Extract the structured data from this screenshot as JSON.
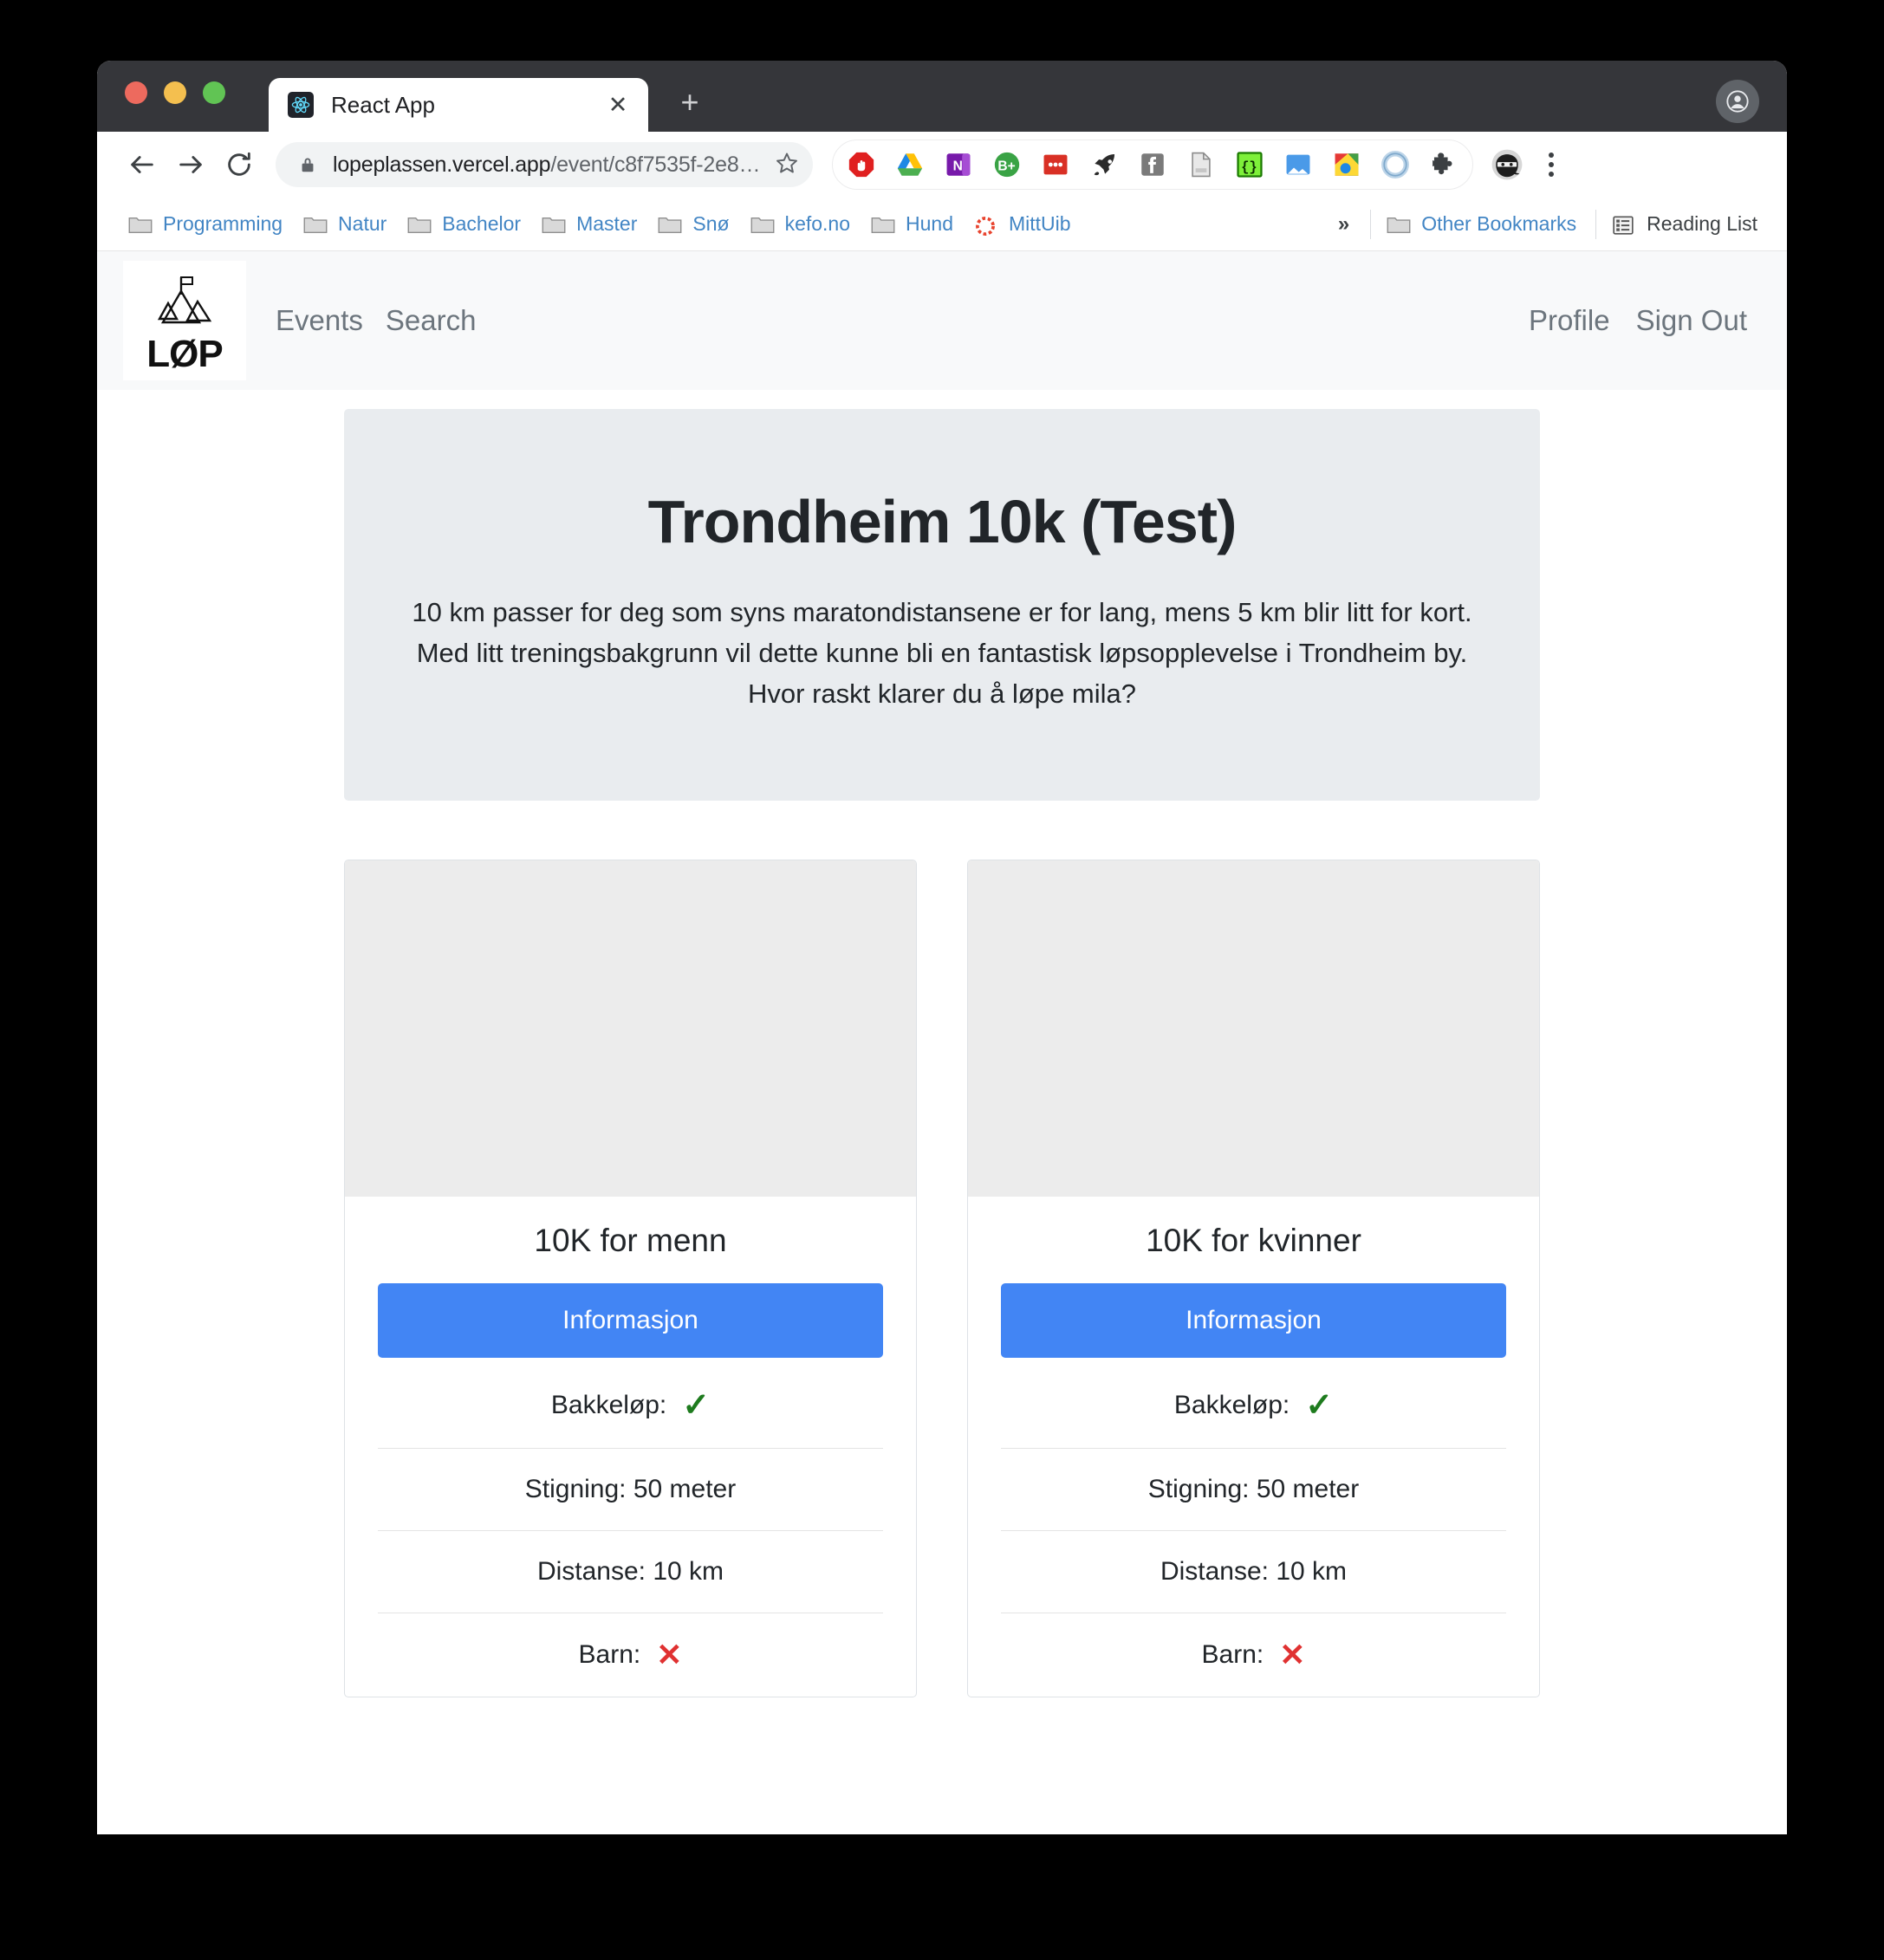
{
  "browser": {
    "tab": {
      "title": "React App",
      "favicon": "react-icon",
      "close_label": "✕"
    },
    "new_tab_label": "+",
    "toolbar": {
      "back_label": "←",
      "forward_label": "→",
      "reload_label": "⟳",
      "url_secure": "lopeplassen.vercel.app",
      "url_path": "/event/c8f7535f-2e8…",
      "url_full": "lopeplassen.vercel.app/event/c8f7535f-2e8…",
      "lock_icon": "lock-icon",
      "star_icon": "star-icon",
      "menu_icon": "kebab-menu-icon",
      "extensions": [
        "adblock-icon",
        "google-drive-icon",
        "onenote-icon",
        "bitwarden-icon",
        "red-dots-icon",
        "rocket-icon",
        "facebook-icon",
        "document-icon",
        "code-brackets-icon",
        "image-icon",
        "colorful-square-icon",
        "blue-ring-icon",
        "puzzle-piece-icon",
        "ninja-avatar-icon"
      ]
    },
    "bookmarks": [
      {
        "label": "Programming",
        "icon": "folder-icon"
      },
      {
        "label": "Natur",
        "icon": "folder-icon"
      },
      {
        "label": "Bachelor",
        "icon": "folder-icon"
      },
      {
        "label": "Master",
        "icon": "folder-icon"
      },
      {
        "label": "Snø",
        "icon": "folder-icon"
      },
      {
        "label": "kefo.no",
        "icon": "folder-icon"
      },
      {
        "label": "Hund",
        "icon": "folder-icon"
      },
      {
        "label": "MittUib",
        "icon": "red-dotted-circle-icon"
      }
    ],
    "bookmarks_overflow": "»",
    "other_bookmarks": {
      "label": "Other Bookmarks",
      "icon": "folder-icon"
    },
    "reading_list": {
      "label": "Reading List",
      "icon": "reading-list-icon"
    }
  },
  "app": {
    "logo": {
      "word": "LØP",
      "icon": "mountain-flag-icon"
    },
    "nav_left": [
      {
        "label": "Events"
      },
      {
        "label": "Search"
      }
    ],
    "nav_right": [
      {
        "label": "Profile"
      },
      {
        "label": "Sign Out"
      }
    ]
  },
  "event": {
    "title": "Trondheim 10k (Test)",
    "description": "10 km passer for deg som syns maratondistansene er for lang, mens 5 km blir litt for kort. Med litt treningsbakgrunn vil dette kunne bli en fantastisk løpsopplevelse i Trondheim by. Hvor raskt klarer du å løpe mila?"
  },
  "races": [
    {
      "title": "10K for menn",
      "button_label": "Informasjon",
      "attributes": [
        {
          "label": "Bakkeløp:",
          "value": "✓",
          "kind": "check"
        },
        {
          "label": "Stigning: 50 meter",
          "value": "",
          "kind": "text"
        },
        {
          "label": "Distanse: 10 km",
          "value": "",
          "kind": "text"
        },
        {
          "label": "Barn:",
          "value": "✕",
          "kind": "cross"
        }
      ]
    },
    {
      "title": "10K for kvinner",
      "button_label": "Informasjon",
      "attributes": [
        {
          "label": "Bakkeløp:",
          "value": "✓",
          "kind": "check"
        },
        {
          "label": "Stigning: 50 meter",
          "value": "",
          "kind": "text"
        },
        {
          "label": "Distanse: 10 km",
          "value": "",
          "kind": "text"
        },
        {
          "label": "Barn:",
          "value": "✕",
          "kind": "cross"
        }
      ]
    }
  ],
  "colors": {
    "accent_blue": "#4285f4",
    "hero_bg": "#e9ecef",
    "check_green": "#1e7b1e",
    "cross_red": "#e03131",
    "bookmark_blue": "#4285c4"
  }
}
